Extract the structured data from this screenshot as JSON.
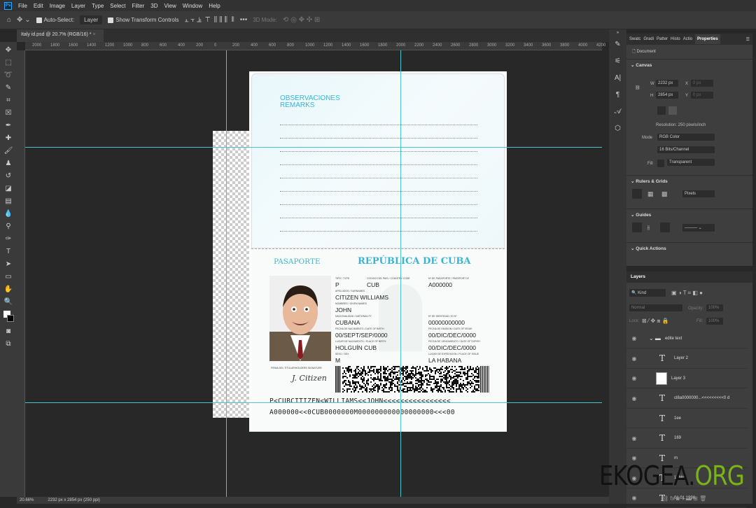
{
  "app": {
    "logo": "Ps",
    "menu": [
      "File",
      "Edit",
      "Image",
      "Layer",
      "Type",
      "Select",
      "Filter",
      "3D",
      "View",
      "Window",
      "Help"
    ]
  },
  "options": {
    "auto_select_label": "Auto-Select:",
    "auto_select_value": "Layer",
    "show_transform_label": "Show Transform Controls",
    "mode_3d": "3D Mode:",
    "more": "•••"
  },
  "document_tab": {
    "title": "Italy id.psd @ 20.7% (RGB/16) *",
    "close": "×"
  },
  "ruler_labels": [
    "2000",
    "1800",
    "1600",
    "1400",
    "1200",
    "1000",
    "800",
    "600",
    "400",
    "200",
    "0",
    "200",
    "400",
    "600",
    "800",
    "1000",
    "1200",
    "1400",
    "1600",
    "1800",
    "2000",
    "2200",
    "2400",
    "2600",
    "2800",
    "3000",
    "3200",
    "3400",
    "3600",
    "3800",
    "4000",
    "4200"
  ],
  "passport": {
    "remarks_es": "OBSERVACIONES",
    "remarks_en": "REMARKS",
    "title_left": "PASAPORTE",
    "title_right": "REPÚBLICA DE CUBA",
    "fields": {
      "type_label": "TIPO / TYPE",
      "type": "P",
      "country_label": "CODIGO DEL PAIS / COUNTRY CODE",
      "country": "CUB",
      "passport_no_label": "Nº DE PASAPORTE / PASSPORT Nº",
      "passport_no": "A000000",
      "surname_label": "APELLIDOS / SURNAMES",
      "surname": "CITIZEN WILLIAMS",
      "given_label": "NOMBRES / GIVEN NAMES",
      "given": "JOHN",
      "nationality_label": "NACIONALIDAD / NATIONALITY",
      "nationality": "CUBANA",
      "id_label": "Nº DE IDENTIDAD / ID Nº",
      "id": "00000000000",
      "dob_label": "FECHA DE NACIMIENTO / DATE OF BIRTH",
      "dob": "00/SEPT/SEP/0000",
      "issue_label": "FECHA DE EMISION / DATE OF ISSUE",
      "issue": "00/DIC/DEC/0000",
      "pob_label": "LUGAR DE NACIMIENTO / PLACE OF BIRTH",
      "pob": "HOLGUÍN  CUB",
      "expiry_label": "FECHA DE VENCIMIENTO / DATE OF EXPIRY",
      "expiry": "00/DIC/DEC/0000",
      "sex_label": "SEXO / SEX",
      "sex": "M",
      "place_issue_label": "LUGAR DE EXPEDICION / PLACE OF ISSUE",
      "place_issue": "LA HABANA",
      "signature_label": "FIRMA DEL TITULAR/HOLDERS SIGNATURE",
      "signature": "J. Citizen"
    },
    "mrz1": "P<CUBCITIZEN<WILLIAMS<<JOHN<<<<<<<<<<<<<<<<",
    "mrz2": "A000000<<0CUB0000000M000000000000000000<<<00"
  },
  "status": {
    "zoom": "20.66%",
    "info": "2232 px x 2854 px (250 ppi)"
  },
  "properties": {
    "tabs": [
      "Swatc",
      "Gradi",
      "Patter",
      "Histo",
      "Actio",
      "Properties"
    ],
    "document_label": "Document",
    "canvas_section": "Canvas",
    "w_label": "W",
    "w": "2232 px",
    "h_label": "H",
    "h": "2854 px",
    "x_label": "X",
    "y_label": "Y",
    "x": "0 px",
    "y": "0 px",
    "resolution": "Resolution: 250 pixels/inch",
    "mode_label": "Mode",
    "mode": "RGB Color",
    "depth": "16 Bits/Channel",
    "fill_label": "Fill",
    "fill": "Transparent",
    "rulers_section": "Rulers & Grids",
    "units": "Pixels",
    "guides_section": "Guides",
    "quick_actions": "Quick Actions"
  },
  "layers": {
    "title": "Layers",
    "filter": "Kind",
    "blend": "Normal",
    "opacity_label": "Opacity:",
    "opacity": "100%",
    "lock_label": "Lock:",
    "fill_label": "Fill:",
    "fill": "100%",
    "items": [
      {
        "name": "edite text",
        "kind": "group"
      },
      {
        "name": "Layer 2",
        "kind": "text"
      },
      {
        "name": "Layer 3",
        "kind": "image"
      },
      {
        "name": "cl8a0000000...<<<<<<<<<0 d",
        "kind": "text"
      },
      {
        "name": "1ee",
        "kind": "text",
        "hidden": true
      },
      {
        "name": "169",
        "kind": "text"
      },
      {
        "name": "m",
        "kind": "text"
      },
      {
        "name": "12bb5",
        "kind": "text"
      },
      {
        "name": "01.01.1990",
        "kind": "text"
      }
    ]
  },
  "watermark": {
    "part1": "EKOGEA.",
    "part2": "ORG",
    "color1": "#111111",
    "color2": "#7ab317"
  },
  "colors": {
    "guide": "#4bc4cf",
    "accent": "#3ab4d0"
  }
}
